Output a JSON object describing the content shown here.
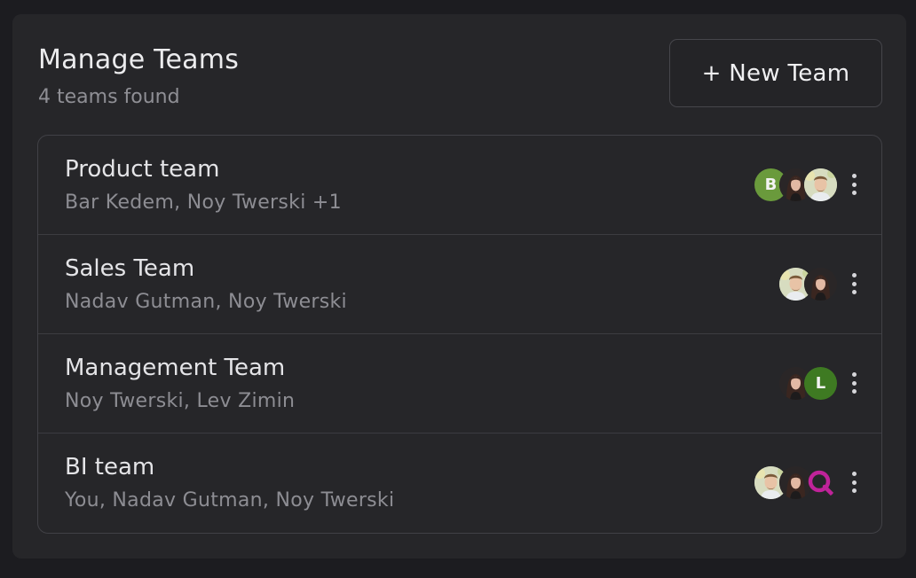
{
  "header": {
    "title": "Manage Teams",
    "subtitle": "4 teams found",
    "new_team_label": "+ New Team"
  },
  "teams": [
    {
      "name": "Product team",
      "members": "Bar Kedem, Noy Twerski +1",
      "avatars": [
        {
          "kind": "initial",
          "text": "B",
          "color": "#6a9a3c"
        },
        {
          "kind": "photo-woman"
        },
        {
          "kind": "photo-man"
        }
      ]
    },
    {
      "name": "Sales Team",
      "members": "Nadav Gutman, Noy Twerski",
      "avatars": [
        {
          "kind": "photo-man"
        },
        {
          "kind": "photo-woman"
        }
      ]
    },
    {
      "name": "Management Team",
      "members": "Noy Twerski, Lev Zimin",
      "avatars": [
        {
          "kind": "photo-woman"
        },
        {
          "kind": "initial",
          "text": "L",
          "color": "#3e7a22"
        }
      ]
    },
    {
      "name": "BI team",
      "members": "You, Nadav Gutman, Noy Twerski",
      "avatars": [
        {
          "kind": "photo-man"
        },
        {
          "kind": "photo-woman"
        },
        {
          "kind": "logo-q",
          "color": "#c0239a"
        }
      ]
    }
  ],
  "icons": {
    "row_menu": "kebab-menu-icon",
    "add": "plus-icon"
  },
  "colors": {
    "background": "#1c1c20",
    "panel": "#262629",
    "border": "#414146",
    "text_primary": "#e4e4e7",
    "text_secondary": "#8d8d93",
    "accent_logo": "#c0239a"
  }
}
